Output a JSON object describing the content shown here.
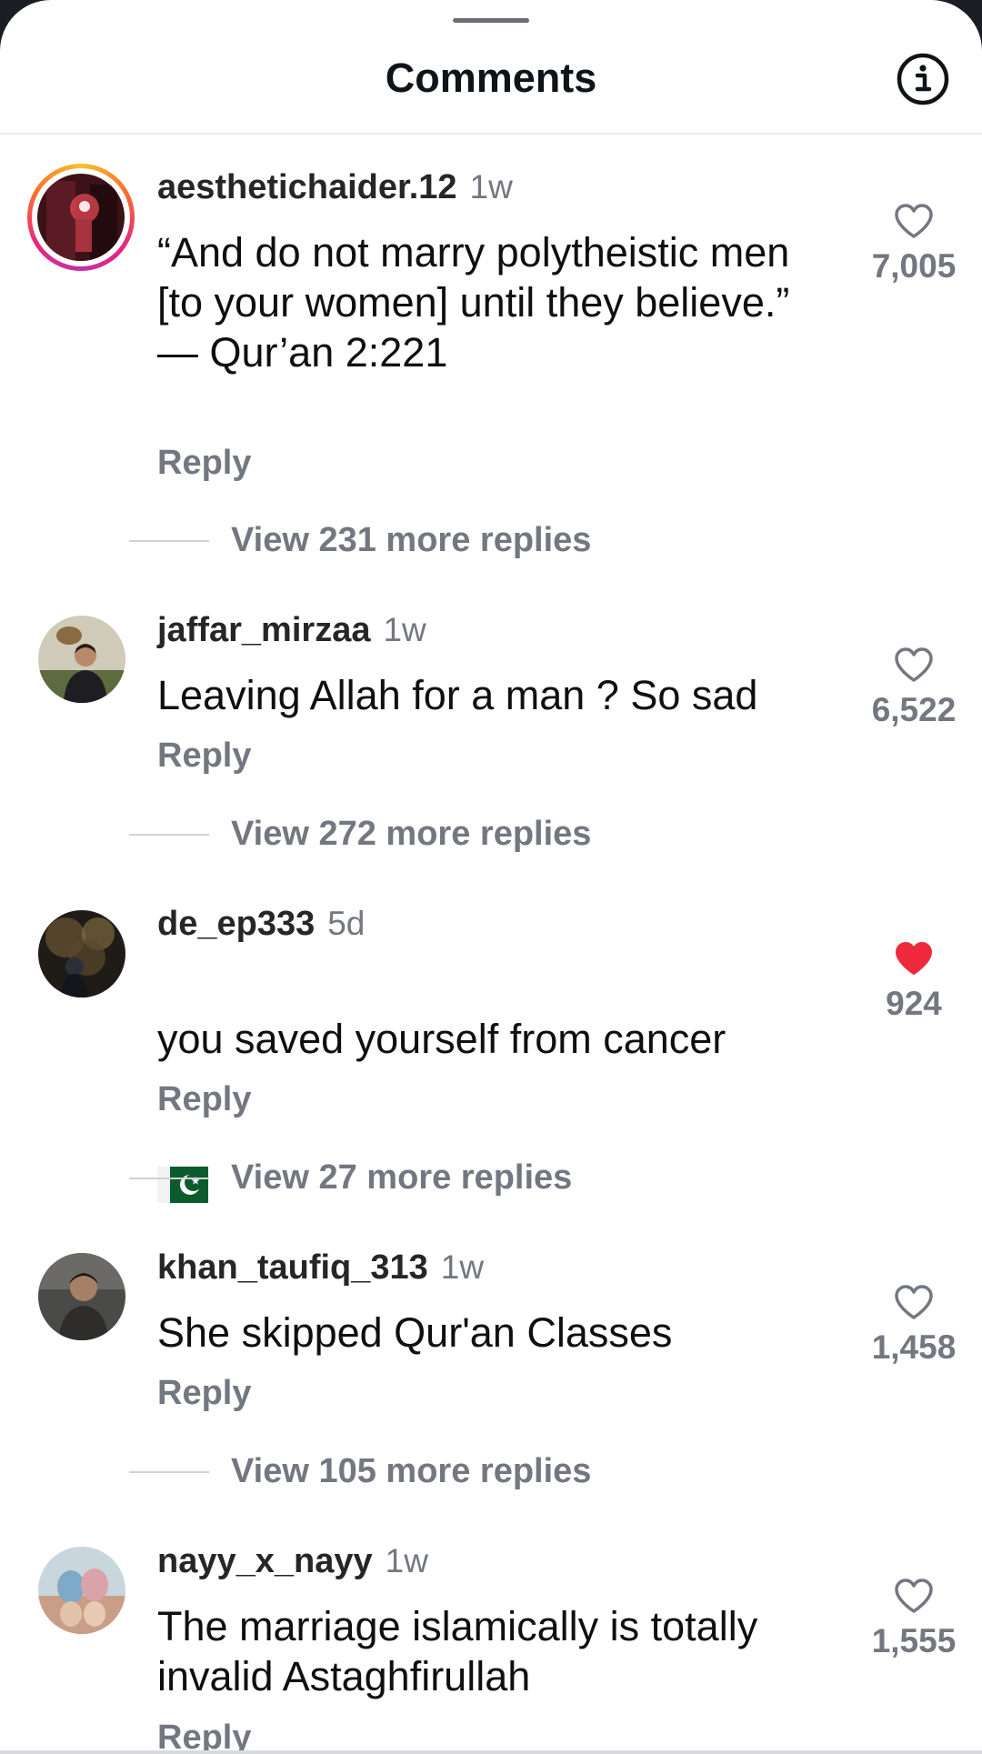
{
  "header": {
    "title": "Comments",
    "info_icon": "info-icon"
  },
  "comments": [
    {
      "username": "aesthetichaider.12",
      "time": "1w",
      "text": "“And do not marry polytheistic men [to your women] until they believe.”\n— Qur’an 2:221",
      "reply_label": "Reply",
      "likes": "7,005",
      "liked": false,
      "has_story": true,
      "replies_label": "View 231 more replies"
    },
    {
      "username": "jaffar_mirzaa",
      "time": "1w",
      "text": "Leaving Allah for a man ? So sad",
      "reply_label": "Reply",
      "likes": "6,522",
      "liked": false,
      "has_story": false,
      "replies_label": "View 272 more replies"
    },
    {
      "username": "de_ep333",
      "time": "5d",
      "text": "you saved yourself from cancer",
      "emoji": "pakistan-flag",
      "reply_label": "Reply",
      "likes": "924",
      "liked": true,
      "has_story": false,
      "replies_label": "View 27 more replies"
    },
    {
      "username": "khan_taufiq_313",
      "time": "1w",
      "text": "She skipped Qur'an Classes",
      "reply_label": "Reply",
      "likes": "1,458",
      "liked": false,
      "has_story": false,
      "replies_label": "View 105 more replies"
    },
    {
      "username": "nayy_x_nayy",
      "time": "1w",
      "text": "The marriage islamically is totally invalid Astaghfirullah",
      "reply_label": "Reply",
      "likes": "1,555",
      "liked": false,
      "has_story": false
    }
  ],
  "colors": {
    "like_active": "#f0283c",
    "muted_text": "#737780",
    "story_ring": [
      "#f9c02b",
      "#e8287b"
    ]
  }
}
